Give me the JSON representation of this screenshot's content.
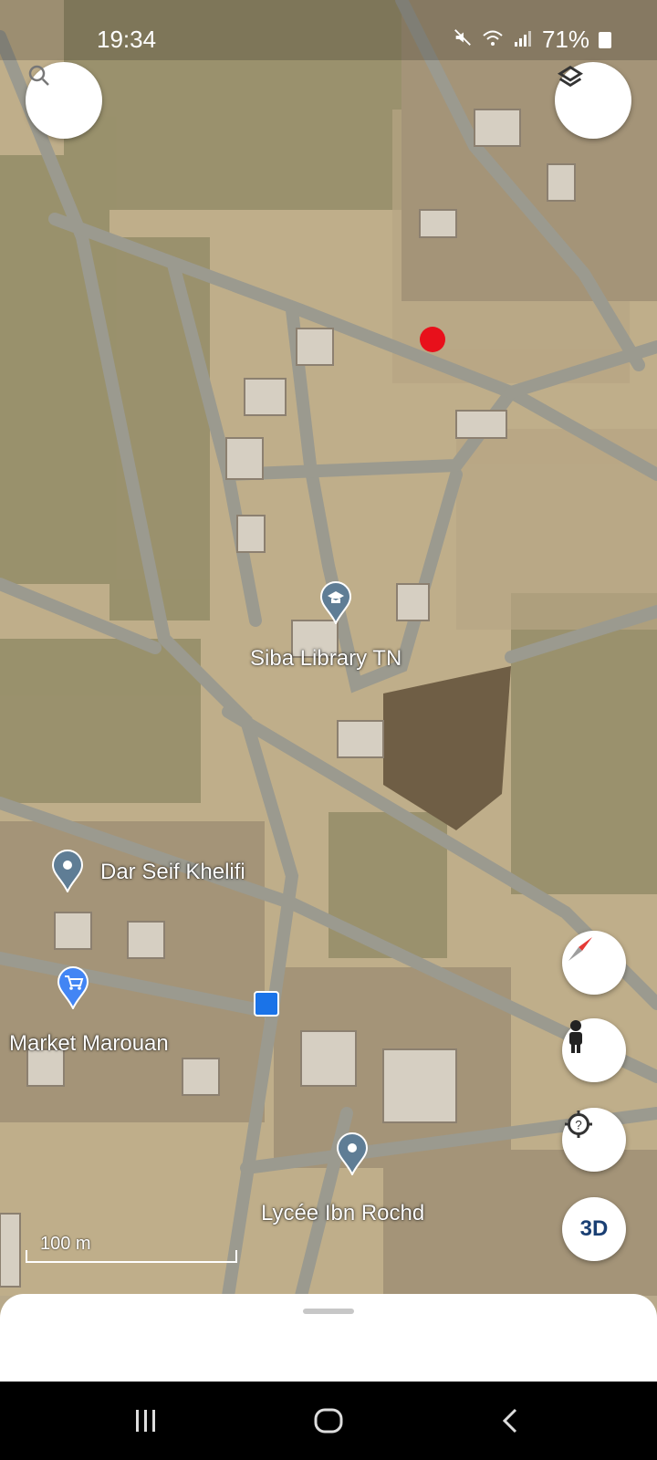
{
  "status_bar": {
    "time": "19:34",
    "battery": "71%"
  },
  "map": {
    "places": [
      {
        "name": "Siba Library TN",
        "icon": "school-icon"
      },
      {
        "name": "Dar Seif Khelifi",
        "icon": "place-pin-icon"
      },
      {
        "name": "Market Marouan",
        "icon": "shopping-cart-icon"
      },
      {
        "name": "Lycée Ibn Rochd",
        "icon": "place-pin-icon"
      }
    ],
    "scale_label": "100 m",
    "selected_point_color": "#e8101b"
  },
  "controls": {
    "search_icon": "search-icon",
    "layers_icon": "layers-icon",
    "compass_icon": "compass-icon",
    "street_view_icon": "pegman-icon",
    "locate_icon": "my-location-icon",
    "three_d_label": "3D"
  },
  "nav": {
    "recents": "recents-icon",
    "home": "home-icon",
    "back": "back-icon"
  }
}
